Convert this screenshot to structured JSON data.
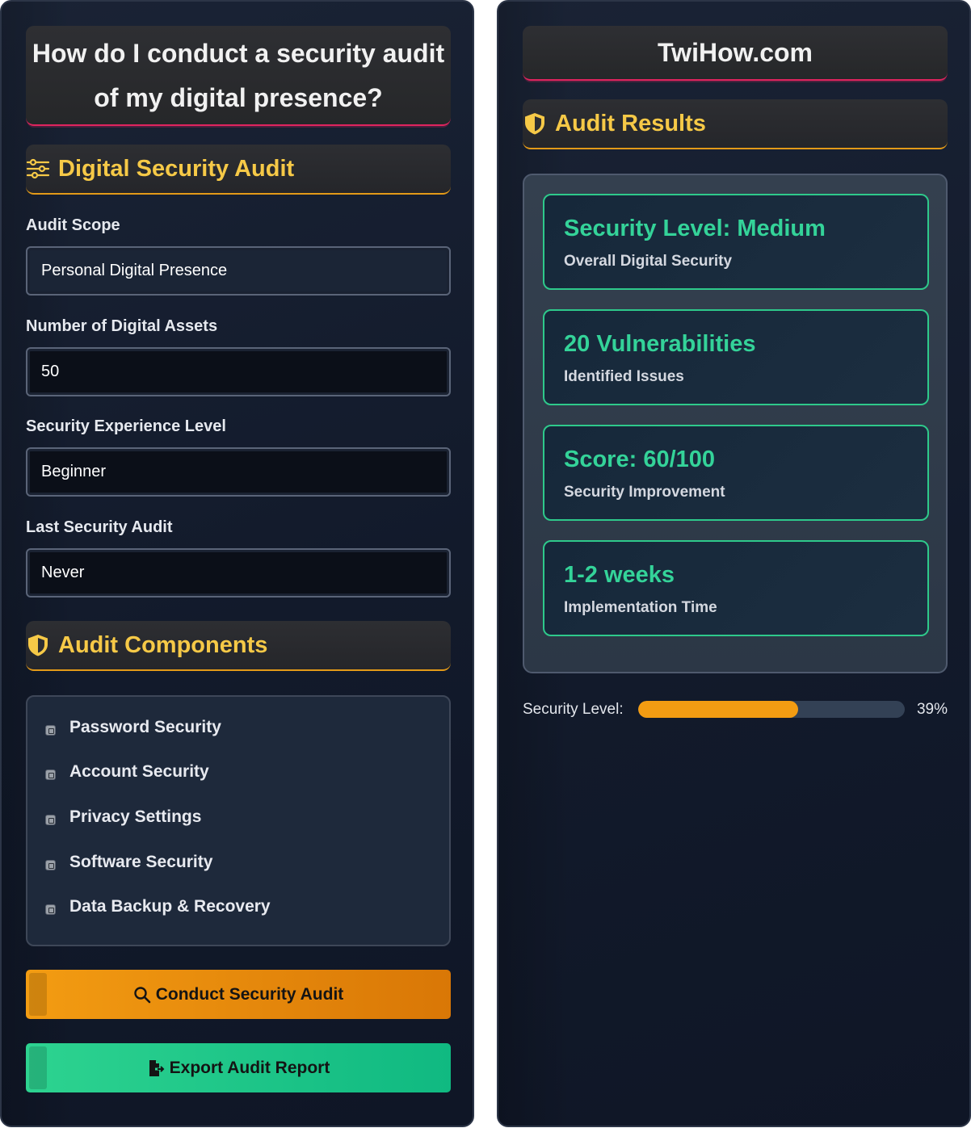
{
  "left": {
    "title": "How do I conduct a security audit of my digital presence?",
    "section_audit": "Digital Security Audit",
    "fields": [
      {
        "label": "Audit Scope",
        "value": "Personal Digital Presence"
      },
      {
        "label": "Number of Digital Assets",
        "value": "50"
      },
      {
        "label": "Security Experience Level",
        "value": "Beginner"
      },
      {
        "label": "Last Security Audit",
        "value": "Never"
      }
    ],
    "section_components": "Audit Components",
    "components": [
      "Password Security",
      "Account Security",
      "Privacy Settings",
      "Software Security",
      "Data Backup & Recovery"
    ],
    "btn_audit": "Conduct Security Audit",
    "btn_export": "Export Audit Report"
  },
  "right": {
    "title": "TwiHow.com",
    "section_results": "Audit Results",
    "results": [
      {
        "title": "Security Level: Medium",
        "sub": "Overall Digital Security"
      },
      {
        "title": "20 Vulnerabilities",
        "sub": "Identified Issues"
      },
      {
        "title": "Score: 60/100",
        "sub": "Security Improvement"
      },
      {
        "title": "1-2 weeks",
        "sub": "Implementation Time"
      }
    ],
    "progress_label": "Security Level:",
    "progress_value": "39%",
    "progress_fraction": 0.6
  },
  "colors": {
    "accent_gold": "#f6c947",
    "accent_green": "#34d399",
    "accent_orange": "#f39c12",
    "title_underline": "#e0245e"
  }
}
